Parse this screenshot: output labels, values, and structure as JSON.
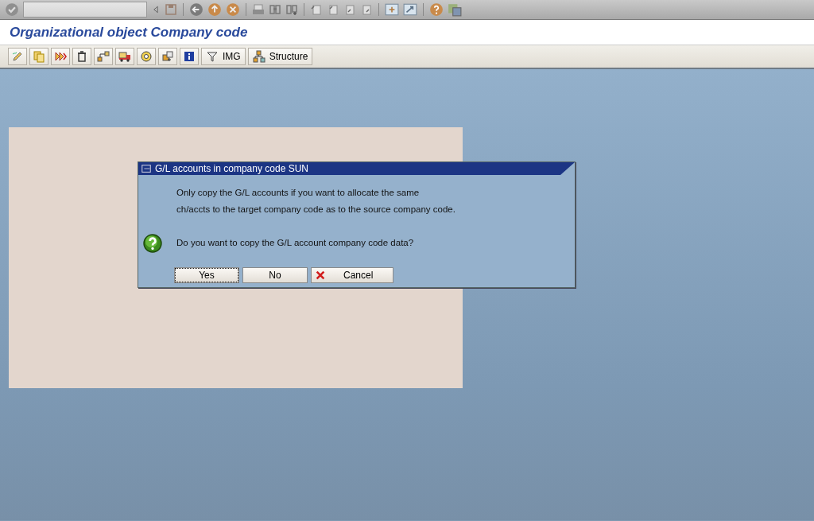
{
  "title_bar": {
    "title": "Organizational object Company code"
  },
  "app_toolbar": {
    "text_buttons": [
      {
        "label": "IMG"
      },
      {
        "label": "Structure"
      }
    ]
  },
  "dialog": {
    "title": "G/L accounts in company code SUN",
    "message_lines": [
      "Only copy the G/L accounts if you want to allocate the same",
      "ch/accts to the target company code as to the source company code."
    ],
    "question": "Do you want to copy the G/L account company code data?",
    "buttons": [
      {
        "label": "Yes",
        "kind": "plain",
        "focused": true
      },
      {
        "label": "No",
        "kind": "plain",
        "focused": false
      },
      {
        "label": "Cancel",
        "kind": "cancel",
        "focused": false
      }
    ]
  }
}
